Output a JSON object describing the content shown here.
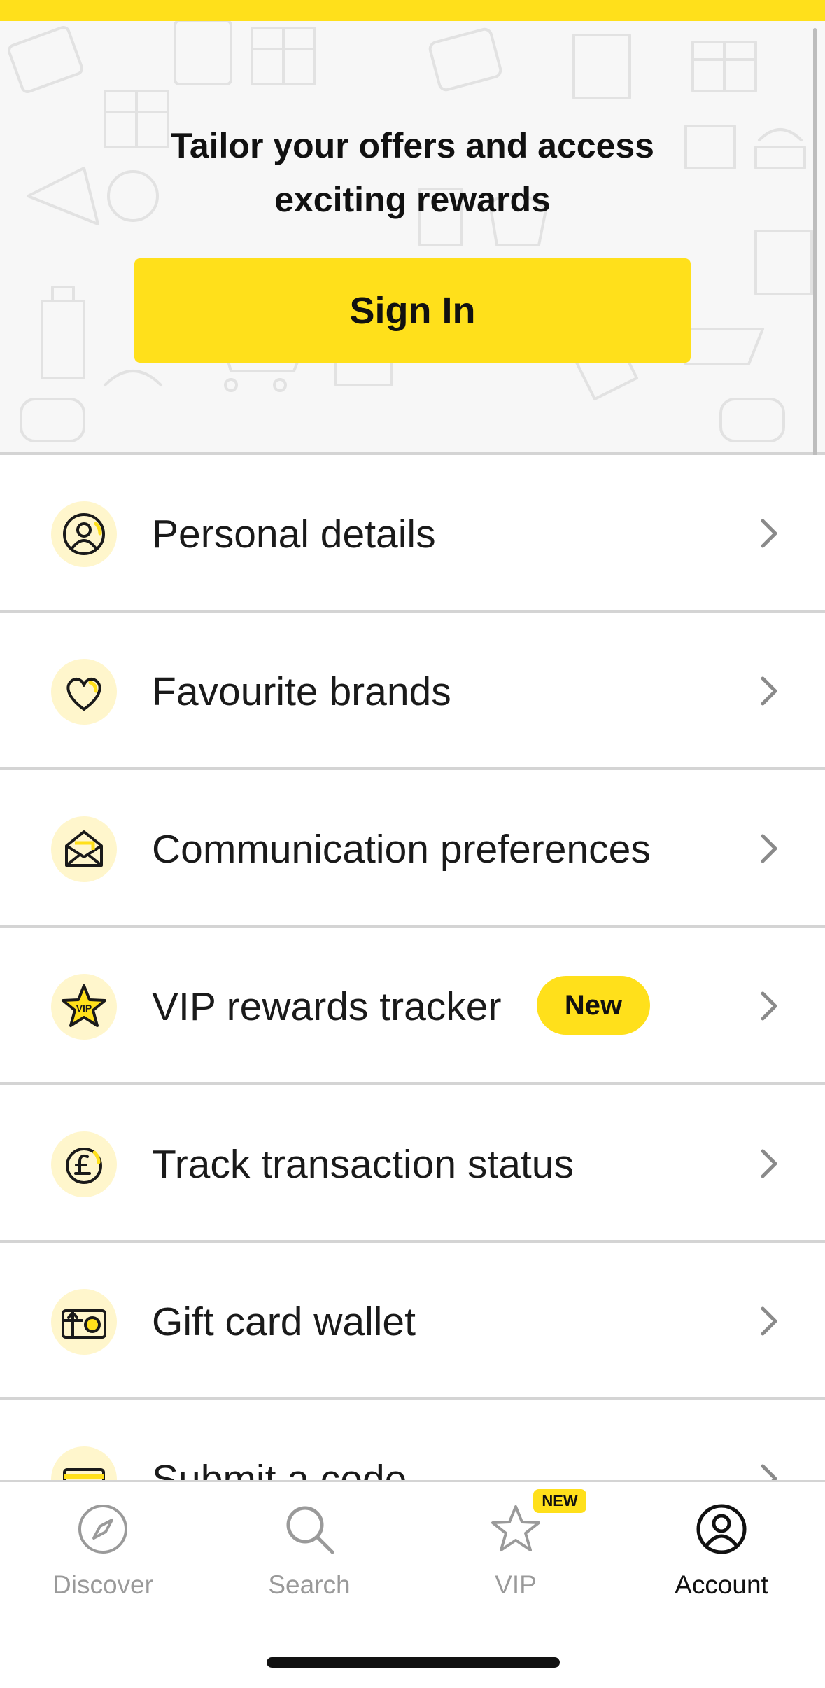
{
  "colors": {
    "accent": "#FFE01B",
    "text": "#1a1a1a",
    "muted": "#9a9a9a",
    "icon_bg": "#FFF6CC"
  },
  "hero": {
    "title_line1": "Tailor your offers and access",
    "title_line2": "exciting rewards",
    "sign_in_label": "Sign In"
  },
  "menu": {
    "items": [
      {
        "label": "Personal details",
        "icon": "user-circle-icon"
      },
      {
        "label": "Favourite brands",
        "icon": "heart-icon"
      },
      {
        "label": "Communication preferences",
        "icon": "envelope-icon"
      },
      {
        "label": "VIP rewards tracker",
        "icon": "vip-star-icon",
        "badge": "New"
      },
      {
        "label": "Track transaction status",
        "icon": "pound-coin-icon"
      },
      {
        "label": "Gift card wallet",
        "icon": "gift-card-icon"
      },
      {
        "label": "Submit a code",
        "icon": "code-ticket-icon"
      }
    ]
  },
  "tabbar": {
    "tabs": [
      {
        "label": "Discover",
        "icon": "compass-icon",
        "active": false
      },
      {
        "label": "Search",
        "icon": "search-icon",
        "active": false
      },
      {
        "label": "VIP",
        "icon": "star-icon",
        "active": false,
        "badge": "NEW"
      },
      {
        "label": "Account",
        "icon": "account-icon",
        "active": true
      }
    ]
  }
}
